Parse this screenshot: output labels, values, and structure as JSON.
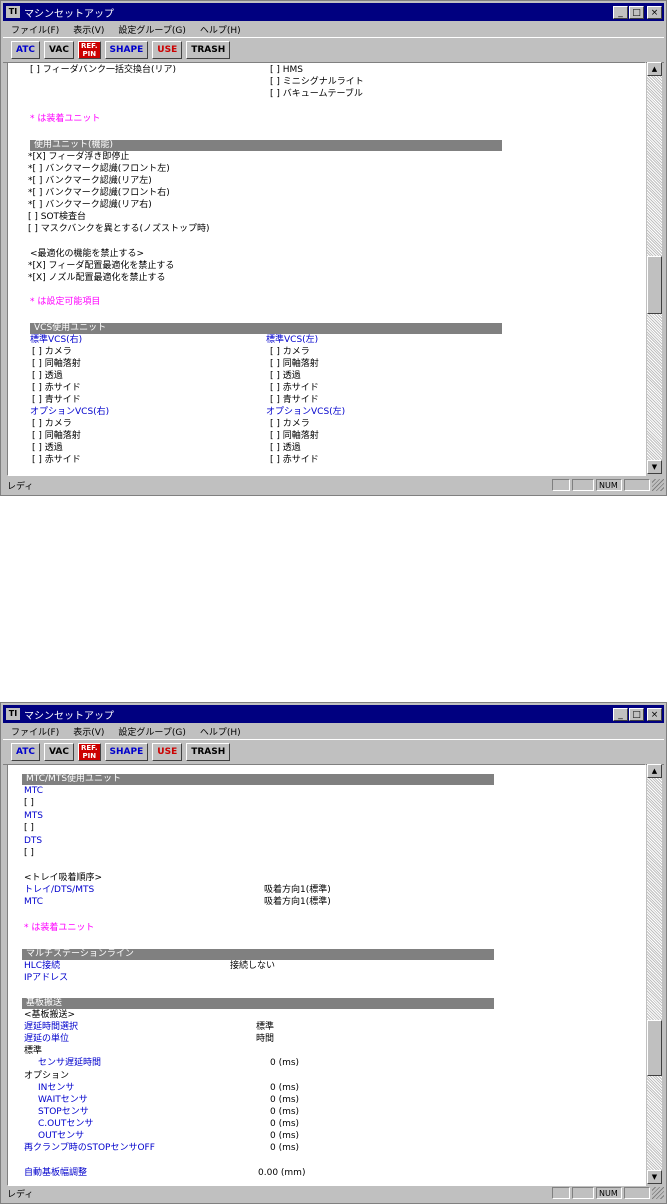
{
  "window_title": "マシンセットアップ",
  "menu": [
    "ファイル(F)",
    "表示(V)",
    "設定グループ(G)",
    "ヘルプ(H)"
  ],
  "toolbar": {
    "atc": "ATC",
    "vac": "VAC",
    "refpin_line1": "REF.",
    "refpin_line2": "PIN",
    "shape": "SHAPE",
    "use": "USE",
    "trash": "TRASH"
  },
  "title_buttons": {
    "minimize": "_",
    "maximize": "□",
    "close": "×"
  },
  "status": {
    "text": "レディ",
    "num": "NUM"
  },
  "win1": {
    "top_left_1": "[ ] フィーダバンク一括交換台(リア)",
    "top_right": [
      "[ ] HMS",
      "[ ] ミニシグナルライト",
      "[ ] バキュームテーブル"
    ],
    "note1": "* は装着ユニット",
    "section_func": "使用ユニット(機能)",
    "func_items": [
      "*[X] フィーダ浮き即停止",
      "*[ ] バンクマーク認識(フロント左)",
      "*[ ] バンクマーク認識(リア左)",
      "*[ ] バンクマーク認識(フロント右)",
      "*[ ] バンクマーク認識(リア右)",
      " [ ] SOT検査台",
      " [ ] マスクバンクを異とする(ノズストップ時)"
    ],
    "opt_header": "<最適化の機能を禁止する>",
    "opt_items": [
      "*[X] フィーダ配置最適化を禁止する",
      "*[X] ノズル配置最適化を禁止する"
    ],
    "note2": "* は設定可能項目",
    "section_vcs": "VCS使用ユニット",
    "vcs_left_std": "標準VCS(右)",
    "vcs_right_std": "標準VCS(左)",
    "vcs_items": [
      "[ ] カメラ",
      "[ ] 同軸落射",
      "[ ] 透過",
      "[ ] 赤サイド",
      "[ ] 青サイド"
    ],
    "vcs_left_opt": "オプションVCS(右)",
    "vcs_right_opt": "オプションVCS(左)",
    "vcs_opt_items": [
      "[ ] カメラ",
      "[ ] 同軸落射",
      "[ ] 透過",
      "[ ] 赤サイド"
    ]
  },
  "win2": {
    "section_mtc": "MTC/MTS使用ユニット",
    "mtc": "MTC",
    "mts": "MTS",
    "dts": "DTS",
    "empty_box": "[ ]",
    "tray_header": "<トレイ吸着順序>",
    "tray_rows": [
      {
        "label": "トレイ/DTS/MTS",
        "value": "吸着方向1(標準)"
      },
      {
        "label": "MTC",
        "value": "吸着方向1(標準)"
      }
    ],
    "note1": "* は装着ユニット",
    "section_multi": "マルチステーションライン",
    "hlc_label": "HLC接続",
    "hlc_value": "接続しない",
    "ip_label": "IPアドレス",
    "section_transport": "基板搬送",
    "transport_header": "<基板搬送>",
    "delay_sel_label": "遅延時間選択",
    "delay_sel_value": "標準",
    "delay_unit_label": "遅延の単位",
    "delay_unit_value": "時間",
    "std_label": "標準",
    "sensor_delay_label": "センサ遅延時間",
    "sensor_delay_value": "0 (ms)",
    "option_label": "オプション",
    "option_rows": [
      {
        "label": "INセンサ",
        "value": "0 (ms)"
      },
      {
        "label": "WAITセンサ",
        "value": "0 (ms)"
      },
      {
        "label": "STOPセンサ",
        "value": "0 (ms)"
      },
      {
        "label": "C.OUTセンサ",
        "value": "0 (ms)"
      },
      {
        "label": "OUTセンサ",
        "value": "0 (ms)"
      }
    ],
    "reclamp_label": "再クランプ時のSTOPセンサOFF",
    "reclamp_value": "0 (ms)",
    "autowidth_label": "自動基板幅調整",
    "autowidth_value": "0.00 (mm)"
  }
}
